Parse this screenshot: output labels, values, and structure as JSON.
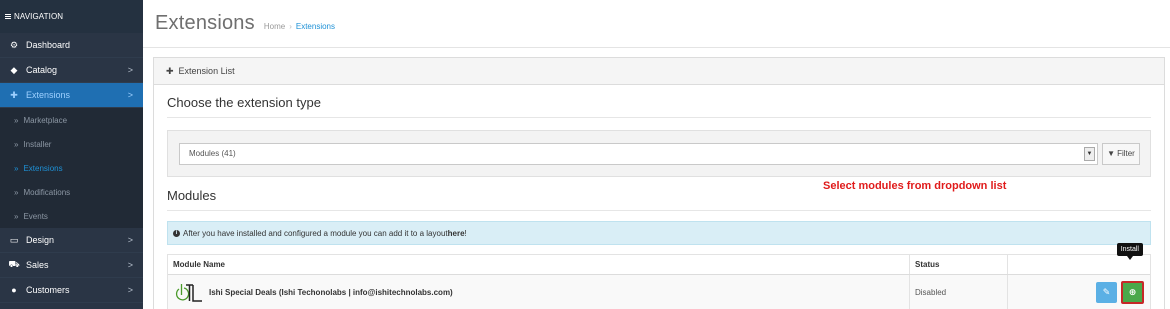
{
  "sidebar": {
    "header": "NAVIGATION",
    "items": [
      {
        "label": "Dashboard",
        "icon": "dashboard-icon",
        "glyph": "⚙",
        "arrow": ""
      },
      {
        "label": "Catalog",
        "icon": "tag-icon",
        "glyph": "◆",
        "arrow": ">"
      },
      {
        "label": "Extensions",
        "icon": "puzzle-icon",
        "glyph": "✚",
        "arrow": ">"
      }
    ],
    "sub_items": [
      {
        "label": "Marketplace"
      },
      {
        "label": "Installer"
      },
      {
        "label": "Extensions"
      },
      {
        "label": "Modifications"
      },
      {
        "label": "Events"
      }
    ],
    "bottom_items": [
      {
        "label": "Design",
        "icon": "monitor-icon",
        "glyph": "▭",
        "arrow": ">"
      },
      {
        "label": "Sales",
        "icon": "cart-icon",
        "glyph": "⛟",
        "arrow": ">"
      },
      {
        "label": "Customers",
        "icon": "user-icon",
        "glyph": "●",
        "arrow": ">"
      }
    ]
  },
  "header": {
    "title": "Extensions",
    "breadcrumb": [
      "Home",
      "Extensions"
    ],
    "breadcrumb_sep": "›"
  },
  "panel": {
    "heading": "Extension List",
    "choose_title": "Choose the extension type",
    "select_value": "Modules (41)",
    "filter_label": "Filter",
    "modules_title": "Modules",
    "annotation": "Select modules from dropdown list",
    "alert_text": "After you have installed and configured a module you can add it to a layout ",
    "alert_link": "here",
    "alert_end": "!"
  },
  "table": {
    "columns": [
      "Module Name",
      "Status",
      ""
    ],
    "rows": [
      {
        "name": "Ishi Special Deals (Ishi Techonolabs | info@ishitechnolabs.com)",
        "status": "Disabled"
      }
    ],
    "tooltip": "Install"
  },
  "colors": {
    "sidebar_bg": "#2a3545",
    "active_item": "#1f6fb2",
    "annotation": "#e01b1b",
    "install_btn": "#4aa84a",
    "edit_btn": "#5bb0e5"
  }
}
